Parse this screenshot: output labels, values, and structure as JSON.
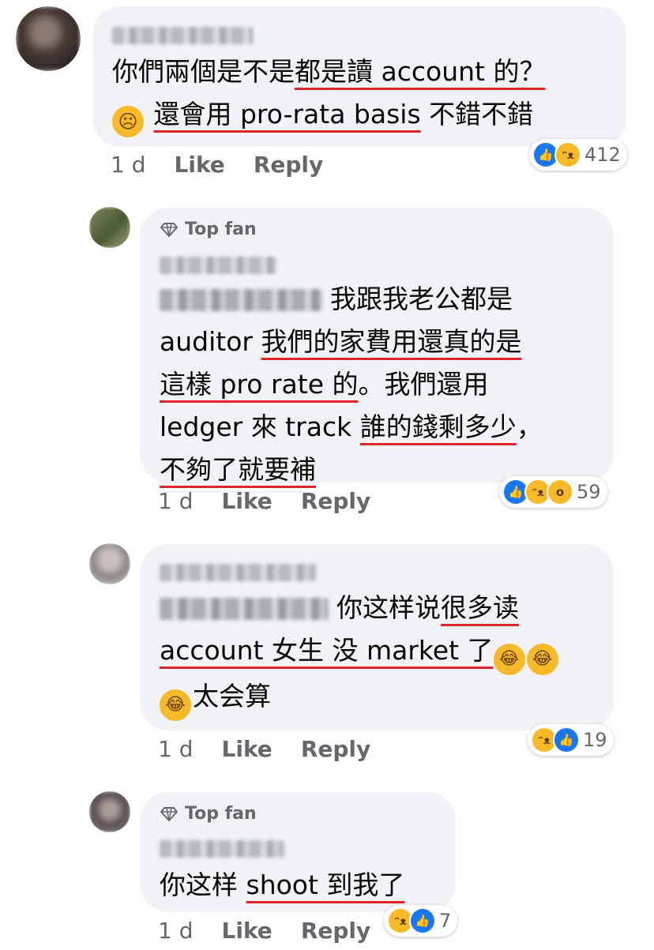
{
  "comments": [
    {
      "line1_plain": "你們兩個是不是",
      "line1_ul": "都是讀 account 的？",
      "line2_ul": "還會用 pro-rata basis",
      "line2_plain": " 不錯不錯",
      "emoji": "worried-face",
      "time": "1 d",
      "like": "Like",
      "reply": "Reply",
      "reactions": "412"
    },
    {
      "badge": "Top fan",
      "l1_plain": "我跟我老公都是",
      "l2_plain": "auditor ",
      "l2_ul": "我們的家費用還真的是",
      "l3_ul": "這樣 pro rate 的",
      "l3_plain": "。我們還用",
      "l4_plain": "ledger 來 track ",
      "l4_ul": "誰的錢剩多少",
      "l4_end": "，",
      "l5_ul": "不夠了就要補",
      "time": "1 d",
      "like": "Like",
      "reply": "Reply",
      "reactions": "59"
    },
    {
      "l1_plain": "你这样说",
      "l1_ul": "很多读",
      "l2_ul": "account 女生 没 market 了",
      "l3_plain": "太会算",
      "time": "1 d",
      "like": "Like",
      "reply": "Reply",
      "reactions": "19"
    },
    {
      "badge": "Top fan",
      "l1_plain": "你这样 ",
      "l1_ul": "shoot 到我了",
      "time": "1 d",
      "like": "Like",
      "reply": "Reply",
      "reactions": "7"
    }
  ],
  "icons": [
    "worried-face-emoji",
    "diamond-icon",
    "like-reaction-icon",
    "haha-reaction-icon",
    "wow-reaction-icon",
    "laughing-tears-emoji"
  ],
  "colors": {
    "bubble": "#f0f2f5",
    "meta": "#65676b",
    "underline": "#e0242b",
    "like_blue": "#1877f2",
    "emoji_yellow": "#f7b928"
  }
}
